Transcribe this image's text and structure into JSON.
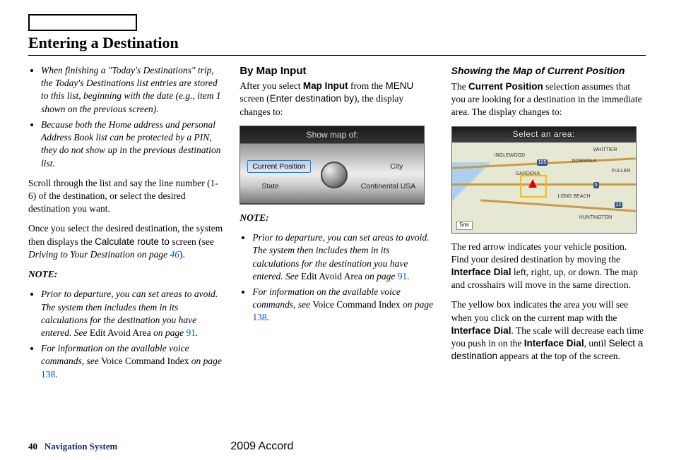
{
  "header": {
    "title": "Entering a Destination"
  },
  "col1": {
    "bullets": [
      "When finishing a \"Today's Destinations\" trip, the Today's Destinations list entries are stored to this list, beginning with the date (e.g., item 1 shown on the previous screen).",
      "Because both the Home address and personal Address Book list can be protected by a PIN, they do not show up in the previous destination list."
    ],
    "scroll": "Scroll through the list and say the line number (1-6) of the destination, or select the desired destination you want.",
    "calc_pre": "Once you select the desired destination, the system then displays the ",
    "calc_mid": "Calculate route to",
    "calc_post": " screen (see ",
    "calc_ref": "Driving to Your Destination",
    "calc_on": " on page ",
    "calc_page": "46",
    "calc_end": ").",
    "note_label": "NOTE:",
    "note1_pre": "Prior to departure, you can set areas to avoid. The system then includes them in its calculations for the destination you have entered. See ",
    "note1_mid": "Edit Avoid Area",
    "note1_post": " on page ",
    "note1_page": "91",
    "note1_end": ".",
    "note2_pre": "For information on the available voice commands, see ",
    "note2_mid": "Voice Command Index",
    "note2_post": " on page ",
    "note2_page": "138",
    "note2_end": "."
  },
  "col2": {
    "heading": "By Map Input",
    "intro_pre": "After you select ",
    "intro_b1": "Map Input",
    "intro_mid": " from the ",
    "intro_menu": "MENU",
    "intro_mid2": " screen (",
    "intro_enter": "Enter destination by",
    "intro_end": "), the display changes to:",
    "dial": {
      "title": "Show map of:",
      "opt_tl": "Current Position",
      "opt_tr": "City",
      "opt_bl": "State",
      "opt_br": "Continental USA"
    },
    "note_label": "NOTE:",
    "note1_pre": "Prior to departure, you can set areas to avoid. The system then includes them in its calculations for the destination you have entered. See ",
    "note1_mid": "Edit Avoid Area",
    "note1_post": " on page ",
    "note1_page": "91",
    "note1_end": ".",
    "note2_pre": "For information on the available voice commands, see ",
    "note2_mid": "Voice Command Index",
    "note2_post": " on page ",
    "note2_page": "138",
    "note2_end": "."
  },
  "col3": {
    "heading": "Showing the Map of Current Position",
    "p1_pre": "The ",
    "p1_b": "Current Position",
    "p1_post": " selection assumes that you are looking for a destination in the immediate area. The display changes to:",
    "map": {
      "title": "Select an area:",
      "labels": [
        "INGLEWOOD",
        "NORWALK",
        "GARDENA",
        "LONG BEACH",
        "HUNTINGTON",
        "WHITTIER",
        "FULLER"
      ],
      "scale": "5mi"
    },
    "p2_pre": "The red arrow indicates your vehicle position. Find your desired destination by moving the ",
    "p2_b": "Interface Dial",
    "p2_post": " left, right, up, or down. The map and crosshairs will move in the same direction.",
    "p3_pre": "The yellow box indicates the area you will see when you click on the current map with the ",
    "p3_b1": "Interface Dial",
    "p3_mid": ". The scale will decrease each time you push in on the ",
    "p3_b2": "Interface Dial",
    "p3_mid2": ", until ",
    "p3_sans": "Select a destination",
    "p3_end": " appears at the top of the screen."
  },
  "footer": {
    "page": "40",
    "section": "Navigation System",
    "model": "2009  Accord"
  }
}
